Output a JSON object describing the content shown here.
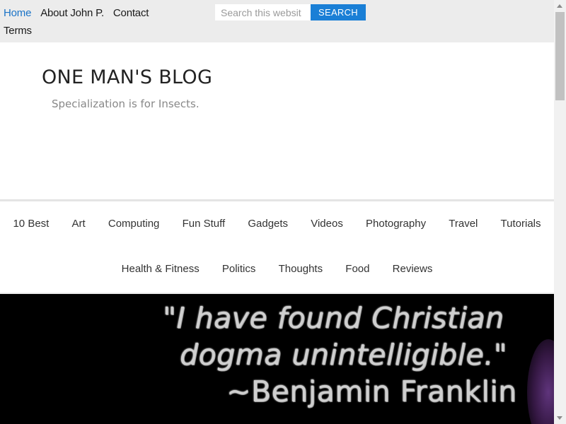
{
  "topnav": {
    "items": [
      {
        "label": "Home",
        "active": true
      },
      {
        "label": "About John P.",
        "active": false
      },
      {
        "label": "Contact",
        "active": false
      },
      {
        "label": "Terms",
        "active": false
      }
    ]
  },
  "search": {
    "placeholder": "Search this websit",
    "button_label": "SEARCH"
  },
  "header": {
    "title": "ONE MAN'S BLOG",
    "tagline": "Specialization is for Insects."
  },
  "categories": {
    "row1": [
      "10 Best",
      "Art",
      "Computing",
      "Fun Stuff",
      "Gadgets",
      "Videos",
      "Photography",
      "Travel",
      "Tutorials"
    ],
    "row2": [
      "Health & Fitness",
      "Politics",
      "Thoughts",
      "Food",
      "Reviews"
    ]
  },
  "hero": {
    "quote_line1": "\"I have found Christian",
    "quote_line2": "dogma unintelligible.\"",
    "quote_line3": "~Benjamin Franklin"
  },
  "colors": {
    "accent": "#1a7fd6",
    "active_link": "#1a73c7",
    "topbar_bg": "#ececec"
  }
}
